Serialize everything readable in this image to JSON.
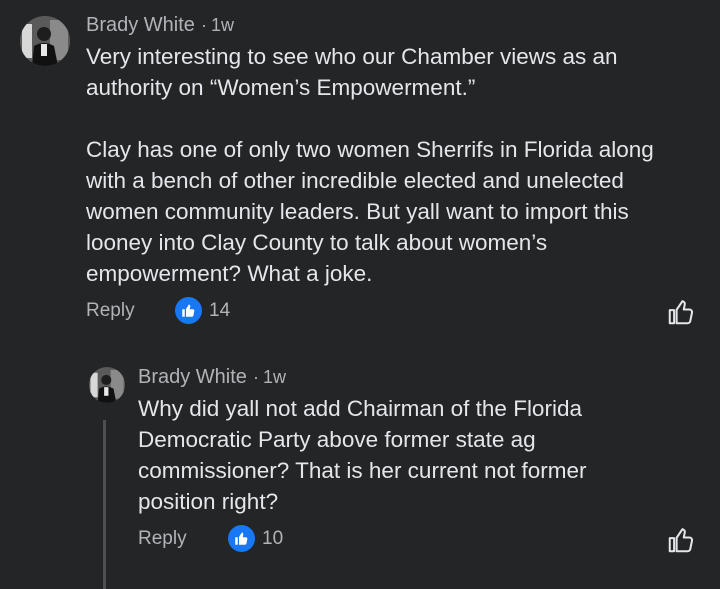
{
  "comments": [
    {
      "author": "Brady White",
      "separator": "·",
      "time": "1w",
      "text": "Very interesting to see who our Chamber views as an\nauthority on “Women’s Empowerment.”\n\nClay has one of only two women Sherrifs in Florida along\nwith a bench of other incredible elected and unelected\nwomen community leaders. But yall want to import this\nlooney into Clay County to talk about women’s\nempowerment? What a joke.",
      "reply_label": "Reply",
      "like_count": "14"
    },
    {
      "author": "Brady White",
      "separator": "·",
      "time": "1w",
      "text": "Why did yall not add Chairman of the Florida\nDemocratic Party above former state ag\ncommissioner? That is her current not former\nposition right?",
      "reply_label": "Reply",
      "like_count": "10"
    }
  ],
  "colors": {
    "background": "#242526",
    "text_primary": "#e4e6eb",
    "text_secondary": "#b0b3b8",
    "like_blue": "#1877f2",
    "thread_line": "#4e4f50"
  },
  "icons": {
    "reaction": "thumbs-up-icon",
    "like_button": "thumbs-up-outline-icon"
  }
}
